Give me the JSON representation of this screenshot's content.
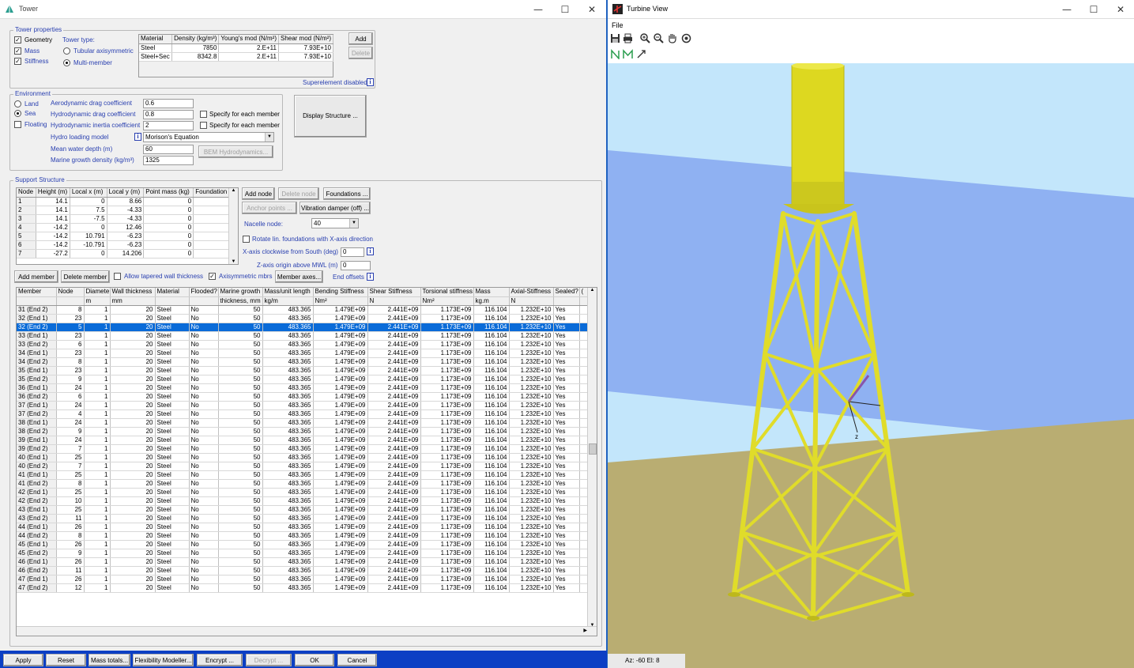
{
  "tower_window": {
    "title": "Tower",
    "minimize": "—",
    "maximize": "☐",
    "close": "✕"
  },
  "tower_properties": {
    "legend": "Tower properties",
    "geometry": "Geometry",
    "mass": "Mass",
    "stiffness": "Stiffness",
    "tower_type_label": "Tower type:",
    "tubular": "Tubular axisymmetric",
    "multi": "Multi-member",
    "material_headers": [
      "Material",
      "Density (kg/m³)",
      "Young's mod (N/m²)",
      "Shear mod (N/m²)"
    ],
    "materials": [
      [
        "Steel",
        "7850",
        "2.E+11",
        "7.93E+10"
      ],
      [
        "Steel+Sec",
        "8342.8",
        "2.E+11",
        "7.93E+10"
      ]
    ],
    "add": "Add",
    "delete": "Delete",
    "superelement": "Superelement disabled"
  },
  "environment": {
    "legend": "Environment",
    "land": "Land",
    "sea": "Sea",
    "floating": "Floating",
    "aero_label": "Aerodynamic drag coefficient",
    "aero_val": "0.6",
    "hydro_drag_label": "Hydrodynamic drag coefficient",
    "hydro_drag_val": "0.8",
    "hydro_inertia_label": "Hydrodynamic inertia coefficient",
    "hydro_inertia_val": "2",
    "specify1": "Specify for each member",
    "specify2": "Specify for each member",
    "hydro_model_label": "Hydro loading model",
    "hydro_model_val": "Morison's Equation",
    "depth_label": "Mean water depth (m)",
    "depth_val": "60",
    "growth_label": "Marine growth density  (kg/m³)",
    "growth_val": "1325",
    "bem": "BEM Hydrodynamics...",
    "display": "Display Structure ..."
  },
  "support": {
    "legend": "Support Structure",
    "node_headers": [
      "Node",
      "Height (m)",
      "Local x (m)",
      "Local y (m)",
      "Point mass (kg)",
      "Foundation"
    ],
    "nodes": [
      [
        "1",
        "14.1",
        "0",
        "8.66",
        "0",
        ""
      ],
      [
        "2",
        "14.1",
        "7.5",
        "-4.33",
        "0",
        ""
      ],
      [
        "3",
        "14.1",
        "-7.5",
        "-4.33",
        "0",
        ""
      ],
      [
        "4",
        "-14.2",
        "0",
        "12.46",
        "0",
        ""
      ],
      [
        "5",
        "-14.2",
        "10.791",
        "-6.23",
        "0",
        ""
      ],
      [
        "6",
        "-14.2",
        "-10.791",
        "-6.23",
        "0",
        ""
      ],
      [
        "7",
        "-27.2",
        "0",
        "14.206",
        "0",
        ""
      ]
    ],
    "add_node": "Add node",
    "delete_node": "Delete node",
    "foundations": "Foundations ...",
    "anchor": "Anchor points ...",
    "vib": "Vibration damper (off) ...",
    "nacelle_label": "Nacelle node:",
    "nacelle_val": "40",
    "rotate": "Rotate lin. foundations with X-axis direction",
    "xaxis_label": "X-axis clockwise from South (deg)",
    "xaxis_val": "0",
    "zaxis_label": "Z-axis origin above MWL (m)",
    "zaxis_val": "0",
    "add_member": "Add member",
    "delete_member": "Delete member",
    "tapered": "Allow tapered wall thickness",
    "axisym": "Axisymmetric mbrs",
    "member_axes": "Member axes...",
    "end_offsets": "End offsets"
  },
  "members": {
    "headers": [
      "Member",
      "Node",
      "Diamete",
      "Wall thickness",
      "Material",
      "Flooded?",
      "Marine growth",
      "Mass/unit length",
      "Bending Stiffness",
      "Shear Stiffness",
      "Torsional stiffness",
      "Mass",
      "Axial-Stiffness",
      "Sealed?",
      "("
    ],
    "units": [
      "",
      "",
      "m",
      "mm",
      "",
      "",
      "thickness, mm",
      "kg/m",
      "Nm²",
      "N",
      "Nm²",
      "kg.m",
      "N",
      "",
      ""
    ],
    "rows": [
      [
        "31 (End 2)",
        "8",
        "1",
        "20",
        "Steel",
        "No",
        "50",
        "483.365",
        "1.479E+09",
        "2.441E+09",
        "1.173E+09",
        "116.104",
        "1.232E+10",
        "Yes"
      ],
      [
        "32 (End 1)",
        "23",
        "1",
        "20",
        "Steel",
        "No",
        "50",
        "483.365",
        "1.479E+09",
        "2.441E+09",
        "1.173E+09",
        "116.104",
        "1.232E+10",
        "Yes"
      ],
      [
        "32 (End 2)",
        "5",
        "1",
        "20",
        "Steel",
        "No",
        "50",
        "483.365",
        "1.479E+09",
        "2.441E+09",
        "1.173E+09",
        "116.104",
        "1.232E+10",
        "Yes"
      ],
      [
        "33 (End 1)",
        "23",
        "1",
        "20",
        "Steel",
        "No",
        "50",
        "483.365",
        "1.479E+09",
        "2.441E+09",
        "1.173E+09",
        "116.104",
        "1.232E+10",
        "Yes"
      ],
      [
        "33 (End 2)",
        "6",
        "1",
        "20",
        "Steel",
        "No",
        "50",
        "483.365",
        "1.479E+09",
        "2.441E+09",
        "1.173E+09",
        "116.104",
        "1.232E+10",
        "Yes"
      ],
      [
        "34 (End 1)",
        "23",
        "1",
        "20",
        "Steel",
        "No",
        "50",
        "483.365",
        "1.479E+09",
        "2.441E+09",
        "1.173E+09",
        "116.104",
        "1.232E+10",
        "Yes"
      ],
      [
        "34 (End 2)",
        "8",
        "1",
        "20",
        "Steel",
        "No",
        "50",
        "483.365",
        "1.479E+09",
        "2.441E+09",
        "1.173E+09",
        "116.104",
        "1.232E+10",
        "Yes"
      ],
      [
        "35 (End 1)",
        "23",
        "1",
        "20",
        "Steel",
        "No",
        "50",
        "483.365",
        "1.479E+09",
        "2.441E+09",
        "1.173E+09",
        "116.104",
        "1.232E+10",
        "Yes"
      ],
      [
        "35 (End 2)",
        "9",
        "1",
        "20",
        "Steel",
        "No",
        "50",
        "483.365",
        "1.479E+09",
        "2.441E+09",
        "1.173E+09",
        "116.104",
        "1.232E+10",
        "Yes"
      ],
      [
        "36 (End 1)",
        "24",
        "1",
        "20",
        "Steel",
        "No",
        "50",
        "483.365",
        "1.479E+09",
        "2.441E+09",
        "1.173E+09",
        "116.104",
        "1.232E+10",
        "Yes"
      ],
      [
        "36 (End 2)",
        "6",
        "1",
        "20",
        "Steel",
        "No",
        "50",
        "483.365",
        "1.479E+09",
        "2.441E+09",
        "1.173E+09",
        "116.104",
        "1.232E+10",
        "Yes"
      ],
      [
        "37 (End 1)",
        "24",
        "1",
        "20",
        "Steel",
        "No",
        "50",
        "483.365",
        "1.479E+09",
        "2.441E+09",
        "1.173E+09",
        "116.104",
        "1.232E+10",
        "Yes"
      ],
      [
        "37 (End 2)",
        "4",
        "1",
        "20",
        "Steel",
        "No",
        "50",
        "483.365",
        "1.479E+09",
        "2.441E+09",
        "1.173E+09",
        "116.104",
        "1.232E+10",
        "Yes"
      ],
      [
        "38 (End 1)",
        "24",
        "1",
        "20",
        "Steel",
        "No",
        "50",
        "483.365",
        "1.479E+09",
        "2.441E+09",
        "1.173E+09",
        "116.104",
        "1.232E+10",
        "Yes"
      ],
      [
        "38 (End 2)",
        "9",
        "1",
        "20",
        "Steel",
        "No",
        "50",
        "483.365",
        "1.479E+09",
        "2.441E+09",
        "1.173E+09",
        "116.104",
        "1.232E+10",
        "Yes"
      ],
      [
        "39 (End 1)",
        "24",
        "1",
        "20",
        "Steel",
        "No",
        "50",
        "483.365",
        "1.479E+09",
        "2.441E+09",
        "1.173E+09",
        "116.104",
        "1.232E+10",
        "Yes"
      ],
      [
        "39 (End 2)",
        "7",
        "1",
        "20",
        "Steel",
        "No",
        "50",
        "483.365",
        "1.479E+09",
        "2.441E+09",
        "1.173E+09",
        "116.104",
        "1.232E+10",
        "Yes"
      ],
      [
        "40 (End 1)",
        "25",
        "1",
        "20",
        "Steel",
        "No",
        "50",
        "483.365",
        "1.479E+09",
        "2.441E+09",
        "1.173E+09",
        "116.104",
        "1.232E+10",
        "Yes"
      ],
      [
        "40 (End 2)",
        "7",
        "1",
        "20",
        "Steel",
        "No",
        "50",
        "483.365",
        "1.479E+09",
        "2.441E+09",
        "1.173E+09",
        "116.104",
        "1.232E+10",
        "Yes"
      ],
      [
        "41 (End 1)",
        "25",
        "1",
        "20",
        "Steel",
        "No",
        "50",
        "483.365",
        "1.479E+09",
        "2.441E+09",
        "1.173E+09",
        "116.104",
        "1.232E+10",
        "Yes"
      ],
      [
        "41 (End 2)",
        "8",
        "1",
        "20",
        "Steel",
        "No",
        "50",
        "483.365",
        "1.479E+09",
        "2.441E+09",
        "1.173E+09",
        "116.104",
        "1.232E+10",
        "Yes"
      ],
      [
        "42 (End 1)",
        "25",
        "1",
        "20",
        "Steel",
        "No",
        "50",
        "483.365",
        "1.479E+09",
        "2.441E+09",
        "1.173E+09",
        "116.104",
        "1.232E+10",
        "Yes"
      ],
      [
        "42 (End 2)",
        "10",
        "1",
        "20",
        "Steel",
        "No",
        "50",
        "483.365",
        "1.479E+09",
        "2.441E+09",
        "1.173E+09",
        "116.104",
        "1.232E+10",
        "Yes"
      ],
      [
        "43 (End 1)",
        "25",
        "1",
        "20",
        "Steel",
        "No",
        "50",
        "483.365",
        "1.479E+09",
        "2.441E+09",
        "1.173E+09",
        "116.104",
        "1.232E+10",
        "Yes"
      ],
      [
        "43 (End 2)",
        "11",
        "1",
        "20",
        "Steel",
        "No",
        "50",
        "483.365",
        "1.479E+09",
        "2.441E+09",
        "1.173E+09",
        "116.104",
        "1.232E+10",
        "Yes"
      ],
      [
        "44 (End 1)",
        "26",
        "1",
        "20",
        "Steel",
        "No",
        "50",
        "483.365",
        "1.479E+09",
        "2.441E+09",
        "1.173E+09",
        "116.104",
        "1.232E+10",
        "Yes"
      ],
      [
        "44 (End 2)",
        "8",
        "1",
        "20",
        "Steel",
        "No",
        "50",
        "483.365",
        "1.479E+09",
        "2.441E+09",
        "1.173E+09",
        "116.104",
        "1.232E+10",
        "Yes"
      ],
      [
        "45 (End 1)",
        "26",
        "1",
        "20",
        "Steel",
        "No",
        "50",
        "483.365",
        "1.479E+09",
        "2.441E+09",
        "1.173E+09",
        "116.104",
        "1.232E+10",
        "Yes"
      ],
      [
        "45 (End 2)",
        "9",
        "1",
        "20",
        "Steel",
        "No",
        "50",
        "483.365",
        "1.479E+09",
        "2.441E+09",
        "1.173E+09",
        "116.104",
        "1.232E+10",
        "Yes"
      ],
      [
        "46 (End 1)",
        "26",
        "1",
        "20",
        "Steel",
        "No",
        "50",
        "483.365",
        "1.479E+09",
        "2.441E+09",
        "1.173E+09",
        "116.104",
        "1.232E+10",
        "Yes"
      ],
      [
        "46 (End 2)",
        "11",
        "1",
        "20",
        "Steel",
        "No",
        "50",
        "483.365",
        "1.479E+09",
        "2.441E+09",
        "1.173E+09",
        "116.104",
        "1.232E+10",
        "Yes"
      ],
      [
        "47 (End 1)",
        "26",
        "1",
        "20",
        "Steel",
        "No",
        "50",
        "483.365",
        "1.479E+09",
        "2.441E+09",
        "1.173E+09",
        "116.104",
        "1.232E+10",
        "Yes"
      ],
      [
        "47 (End 2)",
        "12",
        "1",
        "20",
        "Steel",
        "No",
        "50",
        "483.365",
        "1.479E+09",
        "2.441E+09",
        "1.173E+09",
        "116.104",
        "1.232E+10",
        "Yes"
      ]
    ],
    "selected_index": 2
  },
  "bottom": {
    "apply": "Apply",
    "reset": "Reset",
    "mass": "Mass totals...",
    "flex": "Flexibility Modeller...",
    "encrypt": "Encrypt ...",
    "decrypt": "Decrypt ...",
    "ok": "OK",
    "cancel": "Cancel"
  },
  "turbine_window": {
    "title": "Turbine View",
    "menu_file": "File",
    "status": "Az: -60 El: 8",
    "minimize": "—",
    "maximize": "☐",
    "close": "✕",
    "z_axis": "z"
  },
  "colors": {
    "sky": "#c3e6fb",
    "sea": "#8fb1f2",
    "seabed": "#b9ad72",
    "tower": "#e0dc2a",
    "highlight": "#0a6bd8"
  }
}
